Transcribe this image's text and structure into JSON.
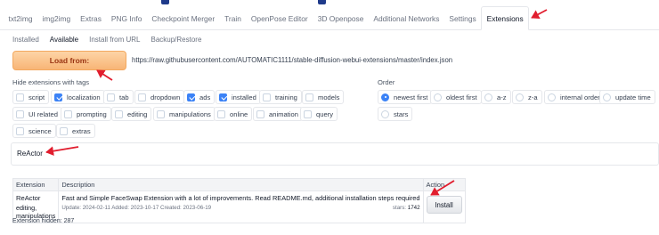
{
  "tabs": [
    "txt2img",
    "img2img",
    "Extras",
    "PNG Info",
    "Checkpoint Merger",
    "Train",
    "OpenPose Editor",
    "3D Openpose",
    "Additional Networks",
    "Settings",
    "Extensions"
  ],
  "active_tab": "Extensions",
  "subtabs": [
    "Installed",
    "Available",
    "Install from URL",
    "Backup/Restore"
  ],
  "active_subtab": "Available",
  "load_button": "Load from:",
  "url": "https://raw.githubusercontent.com/AUTOMATIC1111/stable-diffusion-webui-extensions/master/index.json",
  "hide_label": "Hide extensions with tags",
  "hide_tags": [
    {
      "label": "script",
      "checked": false
    },
    {
      "label": "localization",
      "checked": true
    },
    {
      "label": "tab",
      "checked": false
    },
    {
      "label": "dropdown",
      "checked": false
    },
    {
      "label": "ads",
      "checked": true
    },
    {
      "label": "installed",
      "checked": true
    },
    {
      "label": "training",
      "checked": false
    },
    {
      "label": "models",
      "checked": false
    },
    {
      "label": "UI related",
      "checked": false
    },
    {
      "label": "prompting",
      "checked": false
    },
    {
      "label": "editing",
      "checked": false
    },
    {
      "label": "manipulations",
      "checked": false
    },
    {
      "label": "online",
      "checked": false
    },
    {
      "label": "animation",
      "checked": false
    },
    {
      "label": "query",
      "checked": false
    },
    {
      "label": "science",
      "checked": false
    },
    {
      "label": "extras",
      "checked": false
    }
  ],
  "order_label": "Order",
  "order_options": [
    {
      "label": "newest first",
      "selected": true
    },
    {
      "label": "oldest first",
      "selected": false
    },
    {
      "label": "a-z",
      "selected": false
    },
    {
      "label": "z-a",
      "selected": false
    },
    {
      "label": "internal order",
      "selected": false
    },
    {
      "label": "update time",
      "selected": false
    },
    {
      "label": "stars",
      "selected": false
    }
  ],
  "search_value": "ReActor",
  "table": {
    "headers": [
      "Extension",
      "Description",
      "Action"
    ],
    "rows": [
      {
        "name": "ReActor",
        "tags": "editing, manipulations",
        "description": "Fast and Simple FaceSwap Extension with a lot of improvements. Read README.md, additional installation steps required",
        "meta": "Update: 2024-02-11 Added: 2023-10-17 Created: 2023-06-19",
        "stars_label": "stars:",
        "stars": "1742",
        "action": "Install"
      }
    ]
  },
  "hidden_text": "Extension hidden: 287",
  "colors": {
    "accent": "#3b82f6",
    "load_button": "#f8b576",
    "annotation_arrow": "#e11d2e"
  }
}
